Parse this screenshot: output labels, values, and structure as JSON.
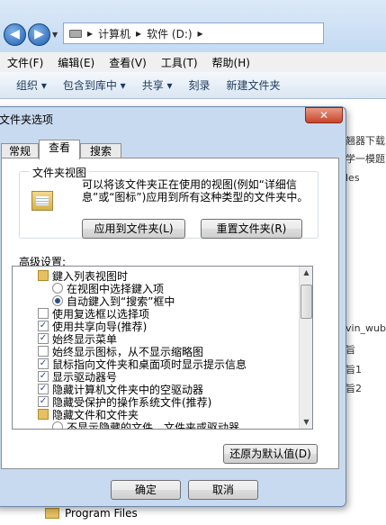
{
  "explorer": {
    "breadcrumb": [
      "计算机",
      "软件 (D:)"
    ],
    "menu": [
      "文件(F)",
      "编辑(E)",
      "查看(V)",
      "工具(T)",
      "帮助(H)"
    ],
    "toolbar": [
      "组织 ▾",
      "包含到库中 ▾",
      "共享 ▾",
      "刻录",
      "新建文件夹"
    ],
    "right_items": [
      "翘器下载",
      "学一模题",
      "les",
      "vin_wubi",
      "旨",
      "旨1",
      "旨2"
    ],
    "bottom_item": "Program Files"
  },
  "dialog": {
    "title": "文件夹选项",
    "close_glyph": "✕",
    "tabs": [
      "常规",
      "查看",
      "搜索"
    ],
    "folder_views": {
      "title": "文件夹视图",
      "description": "可以将该文件夹正在使用的视图(例如“详细信息”或“图标”)应用到所有这种类型的文件夹中。",
      "apply_button": "应用到文件夹(L)",
      "reset_button": "重置文件夹(R)"
    },
    "advanced_label": "高级设置:",
    "settings": [
      {
        "kind": "folder",
        "label": "鍵入列表视图时"
      },
      {
        "kind": "radio",
        "checked": false,
        "label": "在视图中选择鍵入项"
      },
      {
        "kind": "radio",
        "checked": true,
        "label": "自动鍵入到“搜索”框中"
      },
      {
        "kind": "checkbox",
        "checked": false,
        "label": "使用复选框以选择项"
      },
      {
        "kind": "checkbox",
        "checked": true,
        "label": "使用共享向导(推荐)"
      },
      {
        "kind": "checkbox",
        "checked": true,
        "label": "始终显示菜单"
      },
      {
        "kind": "checkbox",
        "checked": false,
        "label": "始终显示图标，从不显示缩略图"
      },
      {
        "kind": "checkbox",
        "checked": true,
        "label": "鼠标指向文件夹和桌面项时显示提示信息"
      },
      {
        "kind": "checkbox",
        "checked": true,
        "label": "显示驱动器号"
      },
      {
        "kind": "checkbox",
        "checked": true,
        "label": "隐藏计算机文件夹中的空驱动器"
      },
      {
        "kind": "checkbox",
        "checked": true,
        "label": "隐藏受保护的操作系统文件(推荐)"
      },
      {
        "kind": "folder",
        "label": "隐藏文件和文件夹"
      },
      {
        "kind": "radio",
        "checked": false,
        "label": "不显示隐藏的文件、文件夹或驱动器"
      }
    ],
    "restore_button": "还原为默认值(D)",
    "ok_button": "确定",
    "cancel_button": "取消"
  },
  "colors": {
    "dialog_frame": "#c8daf0",
    "close_button": "#c8442a",
    "toolbar_text": "#1e395b"
  }
}
